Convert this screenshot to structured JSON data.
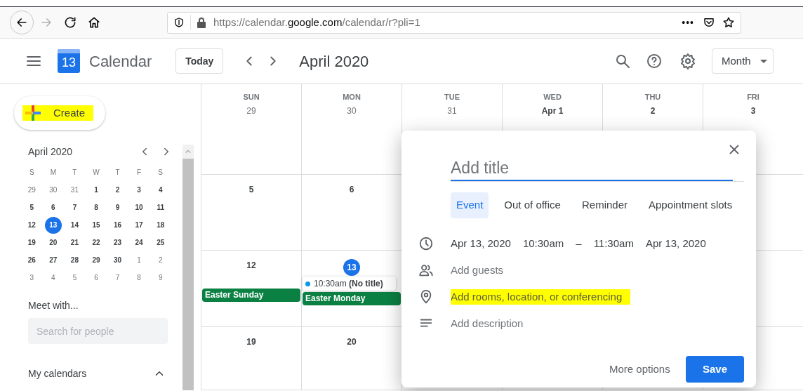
{
  "browser": {
    "back_enabled": true,
    "forward_enabled": false,
    "url": {
      "scheme_host": "https://calendar.",
      "domain": "google.com",
      "path": "/calendar/r?pli=1"
    },
    "menu": "•••"
  },
  "header": {
    "app_name": "Calendar",
    "logo_day": "13",
    "today_button": "Today",
    "period": "April 2020",
    "view_button": "Month"
  },
  "sidebar": {
    "create_button": {
      "label": "Create",
      "highlighted": true
    },
    "mini_calendar": {
      "title": "April 2020",
      "weekdays": [
        "S",
        "M",
        "T",
        "W",
        "T",
        "F",
        "S"
      ],
      "weeks": [
        [
          {
            "day": "29",
            "in_month": false,
            "selected": false
          },
          {
            "day": "30",
            "in_month": false,
            "selected": false
          },
          {
            "day": "31",
            "in_month": false,
            "selected": false
          },
          {
            "day": "1",
            "in_month": true,
            "selected": false
          },
          {
            "day": "2",
            "in_month": true,
            "selected": false
          },
          {
            "day": "3",
            "in_month": true,
            "selected": false
          },
          {
            "day": "4",
            "in_month": true,
            "selected": false
          }
        ],
        [
          {
            "day": "5",
            "in_month": true,
            "selected": false
          },
          {
            "day": "6",
            "in_month": true,
            "selected": false
          },
          {
            "day": "7",
            "in_month": true,
            "selected": false
          },
          {
            "day": "8",
            "in_month": true,
            "selected": false
          },
          {
            "day": "9",
            "in_month": true,
            "selected": false
          },
          {
            "day": "10",
            "in_month": true,
            "selected": false
          },
          {
            "day": "11",
            "in_month": true,
            "selected": false
          }
        ],
        [
          {
            "day": "12",
            "in_month": true,
            "selected": false
          },
          {
            "day": "13",
            "in_month": true,
            "selected": true
          },
          {
            "day": "14",
            "in_month": true,
            "selected": false
          },
          {
            "day": "15",
            "in_month": true,
            "selected": false
          },
          {
            "day": "16",
            "in_month": true,
            "selected": false
          },
          {
            "day": "17",
            "in_month": true,
            "selected": false
          },
          {
            "day": "18",
            "in_month": true,
            "selected": false
          }
        ],
        [
          {
            "day": "19",
            "in_month": true,
            "selected": false
          },
          {
            "day": "20",
            "in_month": true,
            "selected": false
          },
          {
            "day": "21",
            "in_month": true,
            "selected": false
          },
          {
            "day": "22",
            "in_month": true,
            "selected": false
          },
          {
            "day": "23",
            "in_month": true,
            "selected": false
          },
          {
            "day": "24",
            "in_month": true,
            "selected": false
          },
          {
            "day": "25",
            "in_month": true,
            "selected": false
          }
        ],
        [
          {
            "day": "26",
            "in_month": true,
            "selected": false
          },
          {
            "day": "27",
            "in_month": true,
            "selected": false
          },
          {
            "day": "28",
            "in_month": true,
            "selected": false
          },
          {
            "day": "29",
            "in_month": true,
            "selected": false
          },
          {
            "day": "30",
            "in_month": true,
            "selected": false
          },
          {
            "day": "1",
            "in_month": false,
            "selected": false
          },
          {
            "day": "2",
            "in_month": false,
            "selected": false
          }
        ],
        [
          {
            "day": "3",
            "in_month": false,
            "selected": false
          },
          {
            "day": "4",
            "in_month": false,
            "selected": false
          },
          {
            "day": "5",
            "in_month": false,
            "selected": false
          },
          {
            "day": "6",
            "in_month": false,
            "selected": false
          },
          {
            "day": "7",
            "in_month": false,
            "selected": false
          },
          {
            "day": "8",
            "in_month": false,
            "selected": false
          },
          {
            "day": "9",
            "in_month": false,
            "selected": false
          }
        ]
      ]
    },
    "meet_with": {
      "heading": "Meet with...",
      "placeholder": "Search for people"
    },
    "my_calendars": {
      "heading": "My calendars",
      "expanded": true
    }
  },
  "month_grid": {
    "weekdays": [
      "SUN",
      "MON",
      "TUE",
      "WED",
      "THU",
      "FRI"
    ],
    "weeks": [
      {
        "cells": [
          {
            "date": "29",
            "today": false,
            "bold": false
          },
          {
            "date": "30",
            "today": false,
            "bold": false
          },
          {
            "date": "31",
            "today": false,
            "bold": false
          },
          {
            "date": "Apr 1",
            "today": false,
            "bold": true
          },
          {
            "date": "2",
            "today": false,
            "bold": true
          },
          {
            "date": "3",
            "today": false,
            "bold": true
          }
        ]
      },
      {
        "cells": [
          {
            "date": "5",
            "today": false,
            "bold": true
          },
          {
            "date": "6",
            "today": false,
            "bold": true
          }
        ]
      },
      {
        "cells": [
          {
            "date": "12",
            "today": false,
            "bold": true,
            "events": [
              {
                "kind": "allday",
                "title": "Easter Sunday"
              }
            ]
          },
          {
            "date": "13",
            "today": true,
            "bold": true,
            "events": [
              {
                "kind": "timed",
                "time": "10:30am",
                "title": "(No title)"
              },
              {
                "kind": "allday",
                "title": "Easter Monday"
              }
            ]
          }
        ]
      },
      {
        "cells": [
          {
            "date": "19",
            "today": false,
            "bold": true
          },
          {
            "date": "20",
            "today": false,
            "bold": true
          }
        ]
      }
    ]
  },
  "dialog": {
    "title_placeholder": "Add title",
    "tabs": [
      {
        "label": "Event",
        "selected": true
      },
      {
        "label": "Out of office",
        "selected": false
      },
      {
        "label": "Reminder",
        "selected": false
      },
      {
        "label": "Appointment slots",
        "selected": false
      }
    ],
    "rows": [
      {
        "kind": "time",
        "parts": [
          "Apr 13, 2020",
          "10:30am",
          "–",
          "11:30am",
          "Apr 13, 2020"
        ]
      },
      {
        "kind": "guests",
        "text": "Add guests",
        "highlighted": false
      },
      {
        "kind": "location",
        "text": "Add rooms, location, or conferencing",
        "highlighted": true
      },
      {
        "kind": "description",
        "text": "Add description",
        "highlighted": false
      }
    ],
    "more_options": "More options",
    "save": "Save"
  }
}
